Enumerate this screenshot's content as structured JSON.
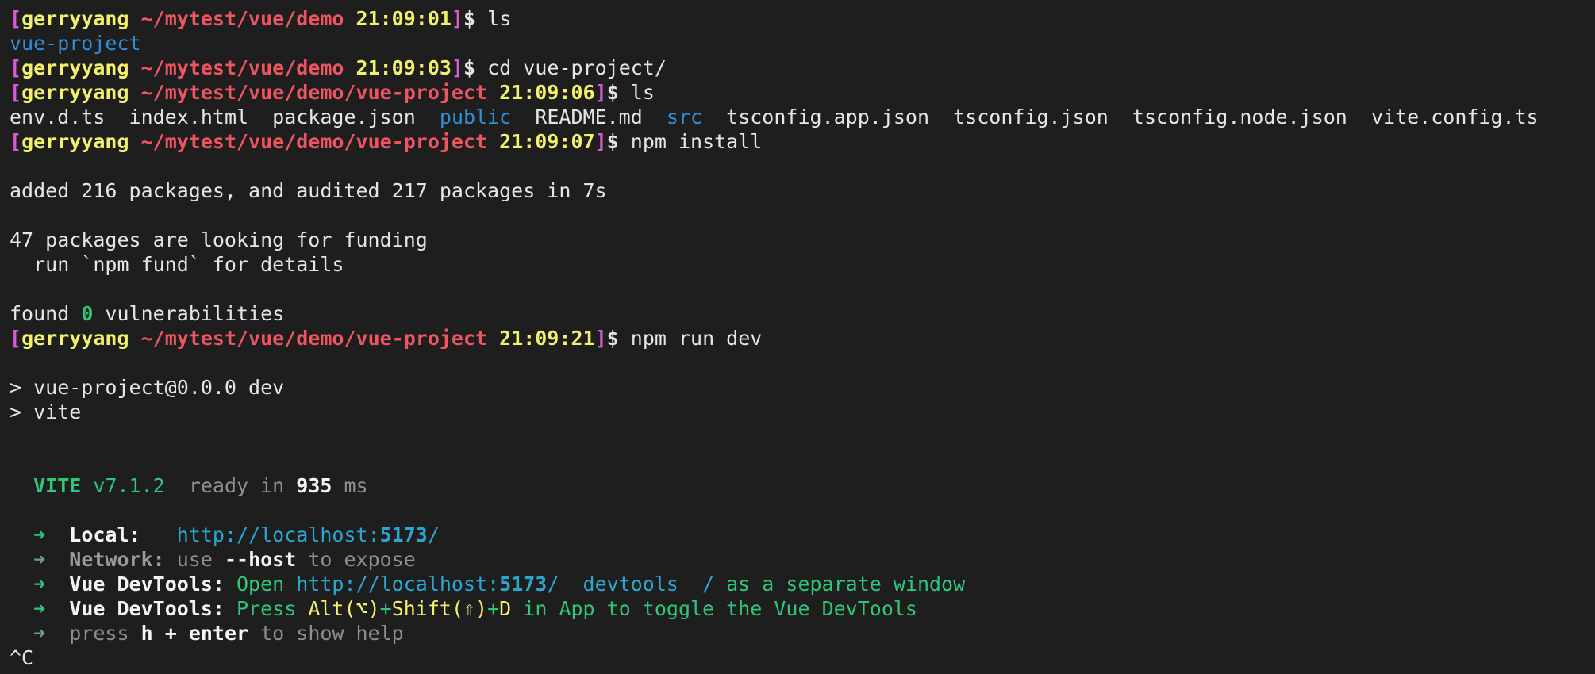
{
  "prompt": {
    "user": "gerryyang",
    "open_bracket": "[",
    "close_bracket": "]",
    "dollar": "$"
  },
  "cmd1": {
    "path": "~/mytest/vue/demo",
    "time": "21:09:01",
    "command": "ls"
  },
  "out_dir": "vue-project",
  "cmd2": {
    "path": "~/mytest/vue/demo",
    "time": "21:09:03",
    "command": "cd vue-project/"
  },
  "cmd3": {
    "path": "~/mytest/vue/demo/vue-project",
    "time": "21:09:06",
    "command": "ls"
  },
  "ls_files": {
    "f1": "env.d.ts",
    "f2": "index.html",
    "f3": "package.json",
    "d1": "public",
    "f4": "README.md",
    "d2": "src",
    "f5": "tsconfig.app.json",
    "f6": "tsconfig.json",
    "f7": "tsconfig.node.json",
    "f8": "vite.config.ts"
  },
  "cmd4": {
    "path": "~/mytest/vue/demo/vue-project",
    "time": "21:09:07",
    "command": "npm install"
  },
  "npm_install": {
    "added": "added 216 packages, and audited 217 packages in 7s",
    "funding": "47 packages are looking for funding",
    "fund_hint": "  run `npm fund` for details",
    "found_prefix": "found ",
    "found_count": "0",
    "found_suffix": " vulnerabilities"
  },
  "cmd5": {
    "path": "~/mytest/vue/demo/vue-project",
    "time": "21:09:21",
    "command": "npm run dev"
  },
  "npm_run": {
    "script_line": "> vue-project@0.0.0 dev",
    "vite_line": "> vite"
  },
  "vite": {
    "name": "VITE",
    "version": "v7.1.2",
    "ready_prefix": "ready in ",
    "ready_ms": "935",
    "ready_unit": " ms"
  },
  "vite_local": {
    "arrow": "➜",
    "label": "Local:",
    "url_prefix": "http://localhost:",
    "port": "5173",
    "url_suffix": "/"
  },
  "vite_network": {
    "arrow": "➜",
    "label": "Network:",
    "text_pre": " use ",
    "flag": "--host",
    "text_post": " to expose"
  },
  "devtools1": {
    "arrow": "➜",
    "label": "Vue DevTools:",
    "open": " Open ",
    "url_prefix": "http://localhost:",
    "port": "5173",
    "url_suffix": "/__devtools__/",
    "tail": " as a separate window"
  },
  "devtools2": {
    "arrow": "➜",
    "label": "Vue DevTools:",
    "press": " Press ",
    "alt": "Alt(⌥)",
    "plus1": "+",
    "shift": "Shift(⇧)",
    "plus2": "+",
    "key": "D",
    "tail": " in App to toggle the Vue DevTools"
  },
  "help": {
    "arrow": "➜",
    "press": "press ",
    "keys": "h + enter",
    "tail": " to show help"
  },
  "interrupt": "^C"
}
